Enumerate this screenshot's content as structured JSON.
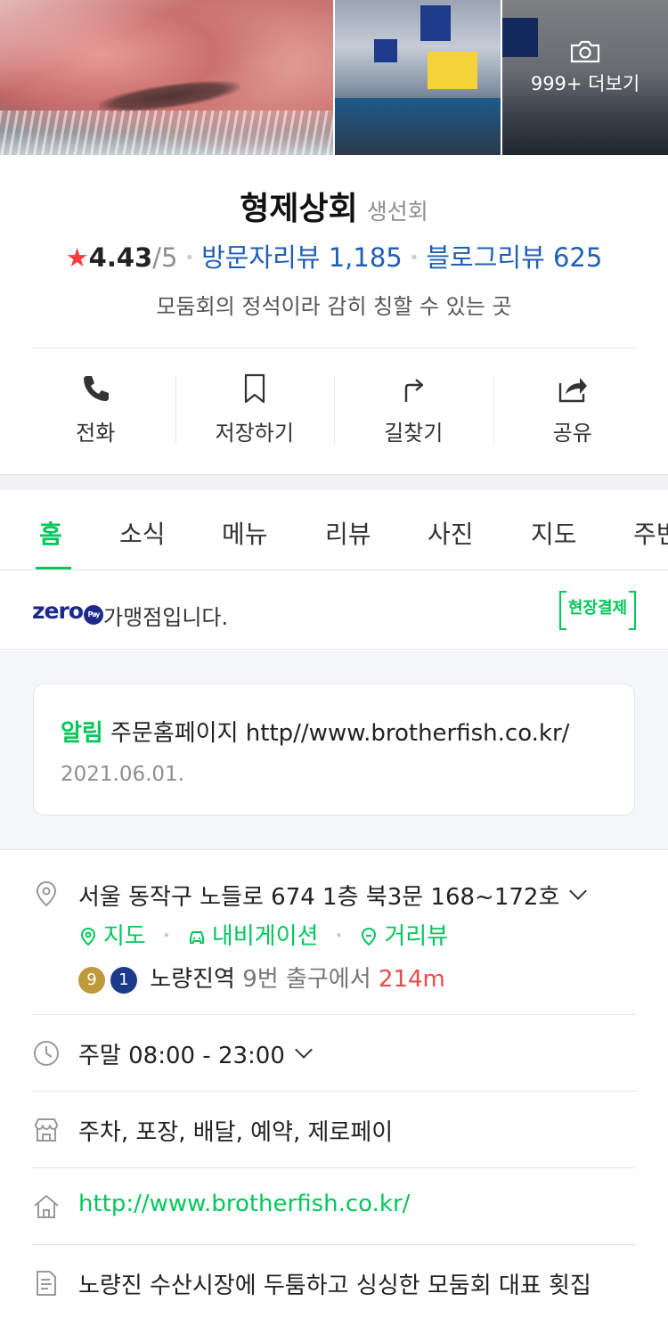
{
  "photos": {
    "more_label": "999+ 더보기"
  },
  "place": {
    "name": "형제상회",
    "category": "생선회",
    "rating": "4.43",
    "rating_max": "/5",
    "visitor_reviews": "방문자리뷰 1,185",
    "blog_reviews": "블로그리뷰 625",
    "tagline": "모둠회의 정석이라 감히 칭할 수 있는 곳"
  },
  "actions": [
    {
      "label": "전화",
      "icon": "phone-icon"
    },
    {
      "label": "저장하기",
      "icon": "bookmark-icon"
    },
    {
      "label": "길찾기",
      "icon": "directions-icon"
    },
    {
      "label": "공유",
      "icon": "share-icon"
    }
  ],
  "tabs": [
    "홈",
    "소식",
    "메뉴",
    "리뷰",
    "사진",
    "지도",
    "주변"
  ],
  "zeropay": {
    "logo": "zero",
    "logo_badge": "Pay",
    "text": "가맹점입니다.",
    "onsite_label": "현장결제"
  },
  "notice": {
    "label": "알림",
    "text": "주문홈페이지 http//www.brotherfish.co.kr/",
    "date": "2021.06.01."
  },
  "info": {
    "address": "서울 동작구 노들로 674 1층 북3문 168~172호",
    "map_link": "지도",
    "navigation_link": "내비게이션",
    "streetview_link": "거리뷰",
    "station_badges": [
      "9",
      "1"
    ],
    "station_name": "노량진역",
    "station_exit": "9번 출구에서",
    "station_distance": "214m",
    "hours": "주말 08:00 - 23:00",
    "amenities": "주차, 포장, 배달, 예약, 제로페이",
    "website": "http://www.brotherfish.co.kr/",
    "description": "노량진 수산시장에 두툼하고 싱싱한 모둠회 대표 횟집"
  },
  "colors": {
    "accent_green": "#03c75a",
    "link_blue": "#1f5fb5",
    "star_red": "#ff3b3b",
    "distance_red": "#e84c4c",
    "line9": "#bd9a3a",
    "line1": "#1c3a8b"
  }
}
